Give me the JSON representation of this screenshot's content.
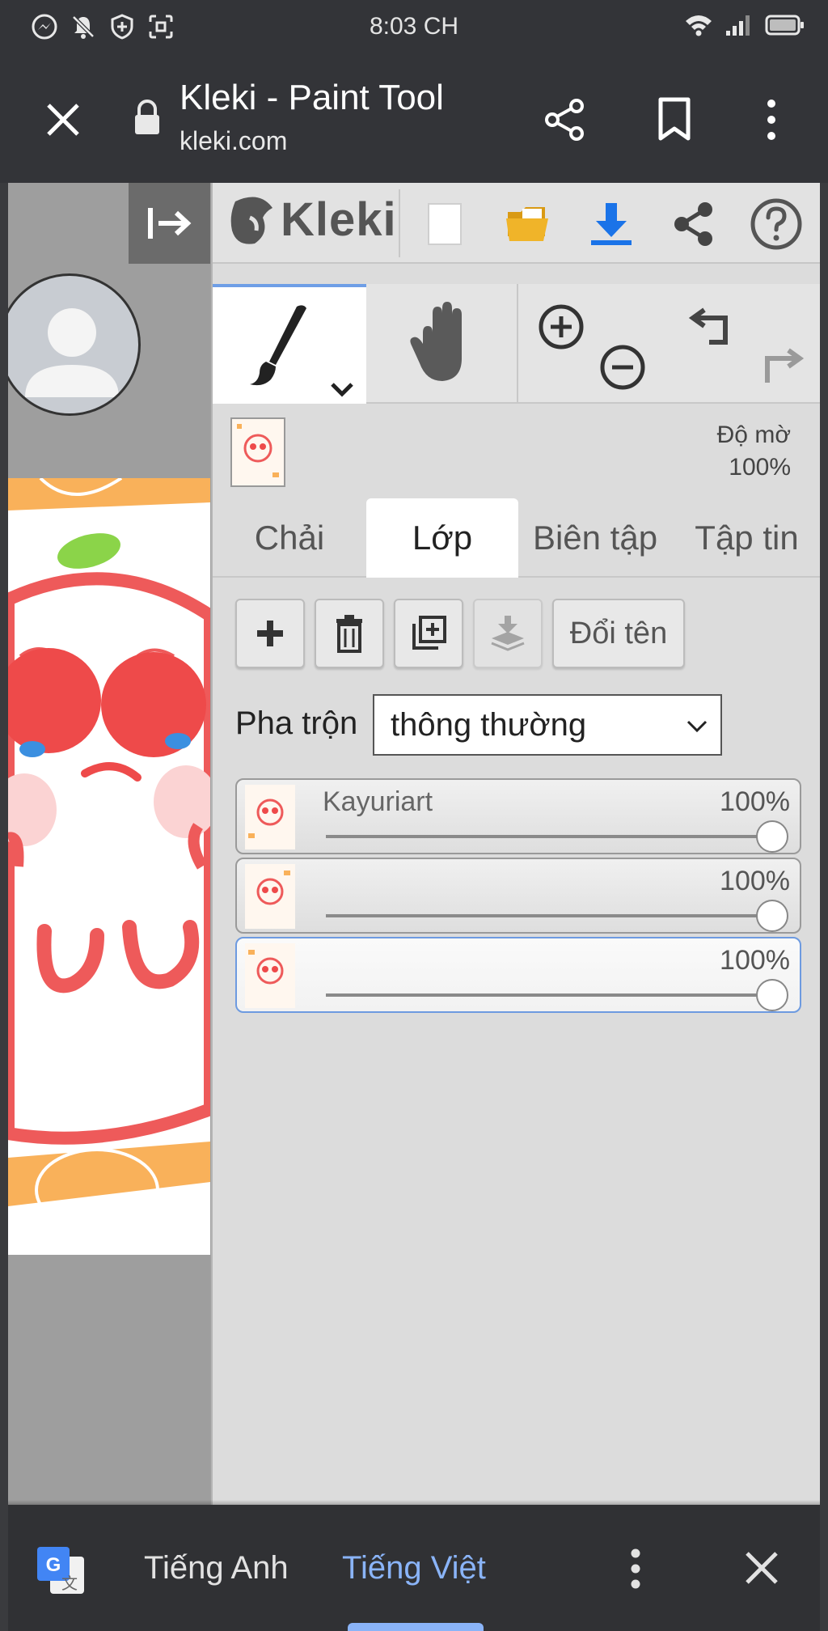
{
  "status_bar": {
    "time": "8:03 CH"
  },
  "browser": {
    "title": "Kleki - Paint Tool",
    "url": "kleki.com"
  },
  "kleki": {
    "logo_text": "Kleki",
    "opacity": {
      "label": "Độ mờ",
      "value": "100%"
    },
    "tabs": [
      {
        "label": "Chải",
        "active": false
      },
      {
        "label": "Lớp",
        "active": true
      },
      {
        "label": "Biên tập",
        "active": false
      },
      {
        "label": "Tập tin",
        "active": false
      }
    ],
    "rename_label": "Đổi tên",
    "blend": {
      "label": "Pha trộn",
      "value": "thông thường"
    },
    "layers": [
      {
        "name": "Kayuriart",
        "opacity": "100%",
        "opacity_value": 1.0,
        "selected": false
      },
      {
        "name": "",
        "opacity": "100%",
        "opacity_value": 1.0,
        "selected": false
      },
      {
        "name": "",
        "opacity": "100%",
        "opacity_value": 1.0,
        "selected": true
      }
    ]
  },
  "translate_bar": {
    "source_lang": "Tiếng Anh",
    "target_lang": "Tiếng Việt"
  },
  "colors": {
    "accent_blue": "#6e9ee6",
    "download_blue": "#1a73e8",
    "folder_yellow": "#f0b429",
    "translate_active": "#8ab4f8"
  }
}
